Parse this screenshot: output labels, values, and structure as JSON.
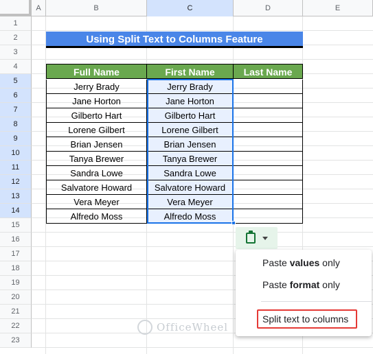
{
  "columns": [
    "A",
    "B",
    "C",
    "D",
    "E"
  ],
  "selected_column": "C",
  "rows": [
    "1",
    "2",
    "3",
    "4",
    "5",
    "6",
    "7",
    "8",
    "9",
    "10",
    "11",
    "12",
    "13",
    "14",
    "15",
    "16",
    "17",
    "18",
    "19",
    "20",
    "21",
    "22",
    "23"
  ],
  "title": "Using Split Text to Columns Feature",
  "table": {
    "headers": [
      "Full Name",
      "First Name",
      "Last Name"
    ],
    "rows": [
      [
        "Jerry Brady",
        "Jerry Brady",
        ""
      ],
      [
        "Jane Horton",
        "Jane Horton",
        ""
      ],
      [
        "Gilberto Hart",
        "Gilberto Hart",
        ""
      ],
      [
        "Lorene Gilbert",
        "Lorene Gilbert",
        ""
      ],
      [
        "Brian Jensen",
        "Brian Jensen",
        ""
      ],
      [
        "Tanya Brewer",
        "Tanya Brewer",
        ""
      ],
      [
        "Sandra Lowe",
        "Sandra Lowe",
        ""
      ],
      [
        "Salvatore Howard",
        "Salvatore Howard",
        ""
      ],
      [
        "Vera Meyer",
        "Vera Meyer",
        ""
      ],
      [
        "Alfredo Moss",
        "Alfredo Moss",
        ""
      ]
    ]
  },
  "paste_menu": {
    "values_prefix": "Paste ",
    "values_bold": "values",
    "values_suffix": " only",
    "format_prefix": "Paste ",
    "format_bold": "format",
    "format_suffix": " only",
    "split_label": "Split text to columns"
  },
  "icons": {
    "paste_chip": "clipboard-icon",
    "dropdown": "caret-down-icon"
  },
  "watermark": "OfficeWheel",
  "colors": {
    "title_bg": "#4a86e8",
    "header_bg": "#6aa84f",
    "selection": "#1a73e8",
    "highlight_box": "#e53935"
  }
}
